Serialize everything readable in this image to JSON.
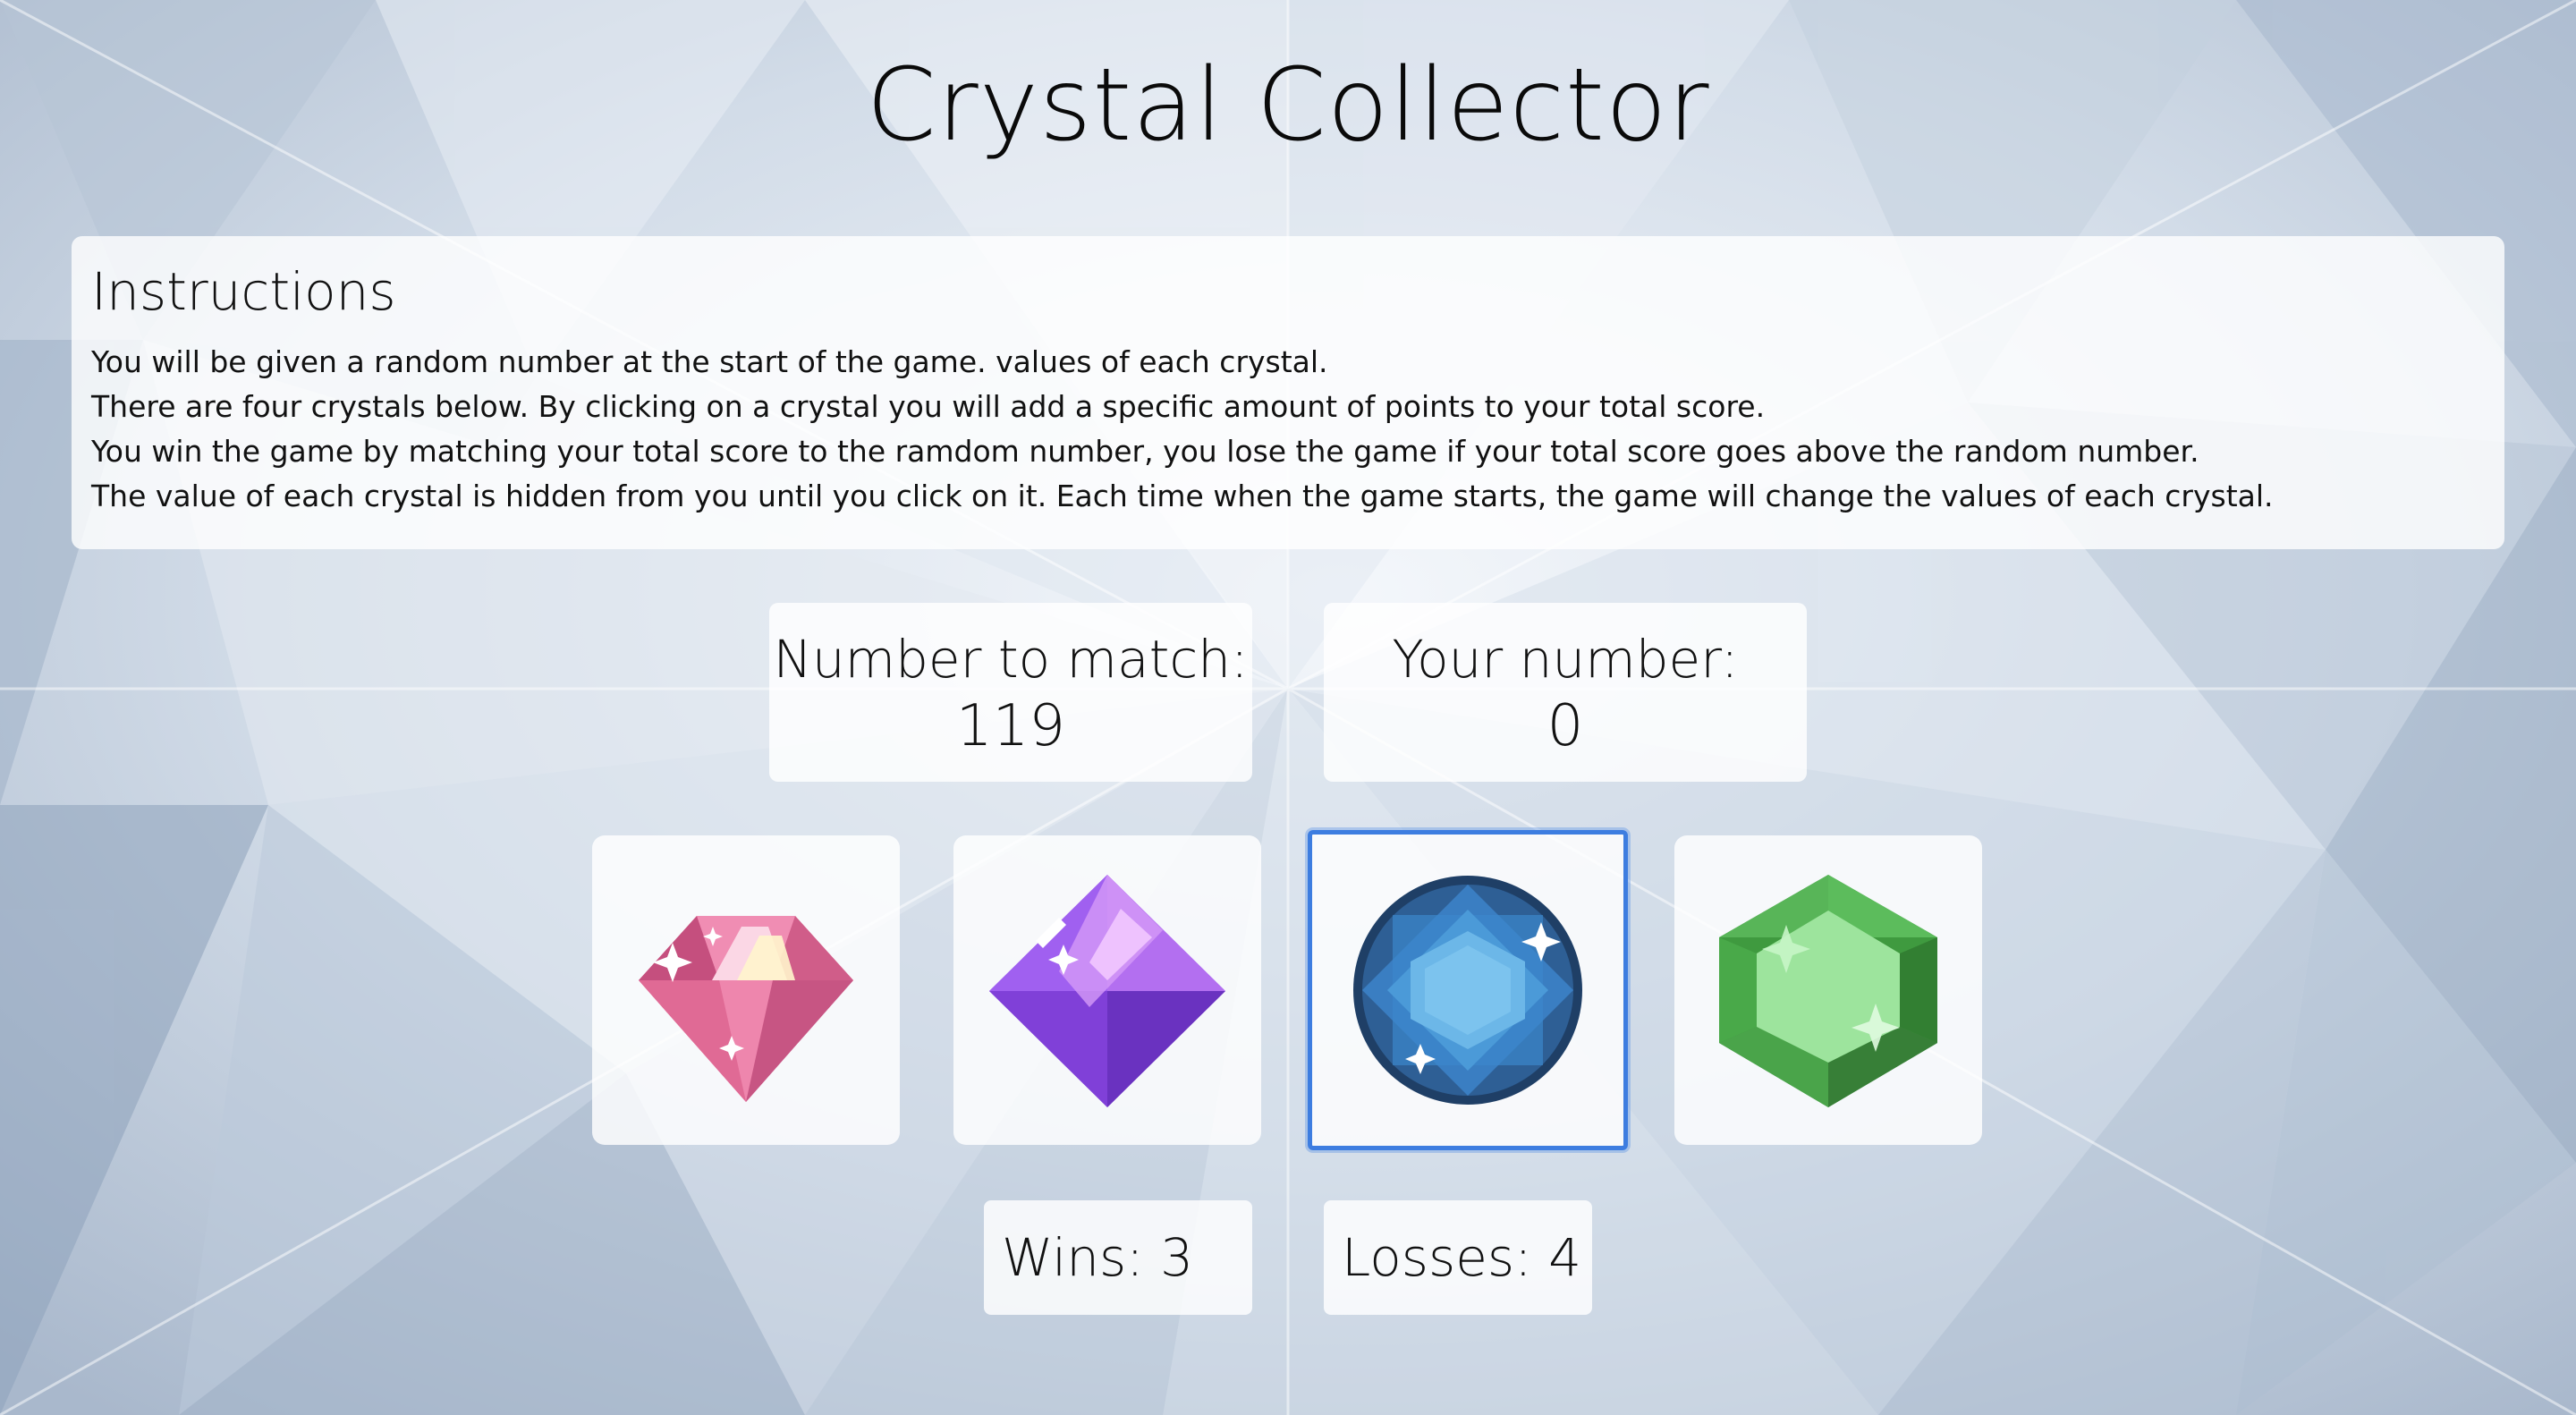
{
  "title": "Crystal Collector",
  "instructions": {
    "heading": "Instructions",
    "lines": [
      "You will be given a random number at the start of the game. values of each crystal.",
      "There are four crystals below. By clicking on a crystal you will add a specific amount of points to your total score.",
      "You win the game by matching your total score to the ramdom number, you lose the game if your total score goes above the random number.",
      "The value of each crystal is hidden from you until you click on it. Each time when the game starts, the game will change the values of each crystal."
    ]
  },
  "target": {
    "label": "Number to match:",
    "value": "119"
  },
  "score": {
    "label": "Your number:",
    "value": "0"
  },
  "crystals": [
    {
      "name": "pink-gem-icon",
      "color": "#e8709c"
    },
    {
      "name": "purple-gem-icon",
      "color": "#9050e8"
    },
    {
      "name": "blue-gem-icon",
      "color": "#3a8ed4",
      "selected": true
    },
    {
      "name": "green-gem-icon",
      "color": "#4caf50"
    }
  ],
  "wins": {
    "label": "Wins: ",
    "value": "3"
  },
  "losses": {
    "label": "Losses: ",
    "value": "4"
  }
}
